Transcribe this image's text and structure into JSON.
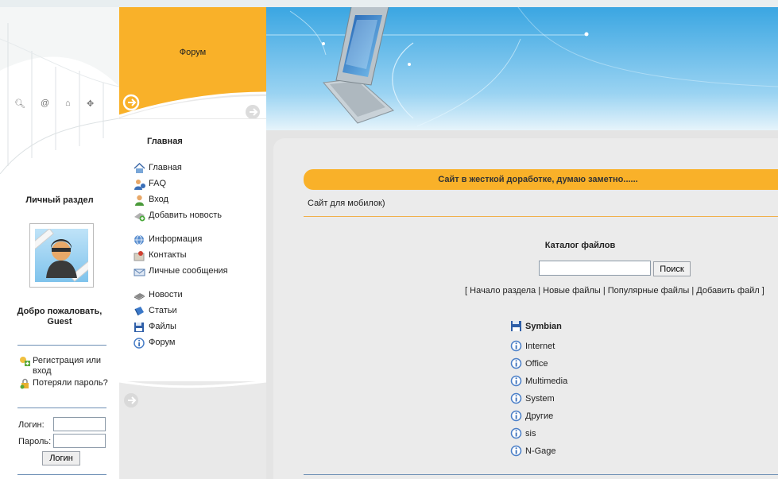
{
  "left": {
    "quick_icons": [
      "search-icon",
      "at-icon",
      "home-icon",
      "move-icon"
    ],
    "personal_title": "Личный раздел",
    "welcome": "Добро пожаловать, Guest",
    "links": [
      {
        "label": "Регистрация или вход",
        "icon": "register-icon"
      },
      {
        "label": "Потеряли пароль?",
        "icon": "lost-password-icon"
      }
    ],
    "login": {
      "login_label": "Логин:",
      "password_label": "Пароль:",
      "login_value": "",
      "password_value": "",
      "button": "Логин"
    }
  },
  "nav": {
    "forum_title": "Форум",
    "heading": "Главная",
    "items": [
      {
        "label": "Главная",
        "icon": "home-icon"
      },
      {
        "label": "FAQ",
        "icon": "faq-icon"
      },
      {
        "label": "Вход",
        "icon": "user-icon"
      },
      {
        "label": "Добавить новость",
        "icon": "add-news-icon"
      },
      {
        "label": "Информация",
        "icon": "globe-icon"
      },
      {
        "label": "Контакты",
        "icon": "contacts-icon"
      },
      {
        "label": "Личные сообщения",
        "icon": "mail-icon"
      },
      {
        "label": "Новости",
        "icon": "news-icon"
      },
      {
        "label": "Статьи",
        "icon": "articles-icon"
      },
      {
        "label": "Файлы",
        "icon": "floppy-icon"
      },
      {
        "label": "Форум",
        "icon": "info-icon"
      }
    ]
  },
  "content": {
    "notice": "Сайт в жесткой доработке, думаю заметно......",
    "subtitle": "Сайт для мобилок)",
    "catalog_title": "Каталог файлов",
    "search": {
      "value": "",
      "button": "Поиск"
    },
    "links": {
      "open": "[",
      "start": "Начало раздела",
      "new": "Новые файлы",
      "popular": "Популярные файлы",
      "add": "Добавить файл",
      "sep": "|",
      "close": "]"
    },
    "category_title": "Symbian",
    "categories": [
      "Internet",
      "Office",
      "Multimedia",
      "System",
      "Другие",
      "sis",
      "N-Gage"
    ]
  },
  "colors": {
    "orange": "#f9b129",
    "sky": "#5ab4e4",
    "panel": "#ebebeb",
    "nav": "#e9e9e9"
  }
}
